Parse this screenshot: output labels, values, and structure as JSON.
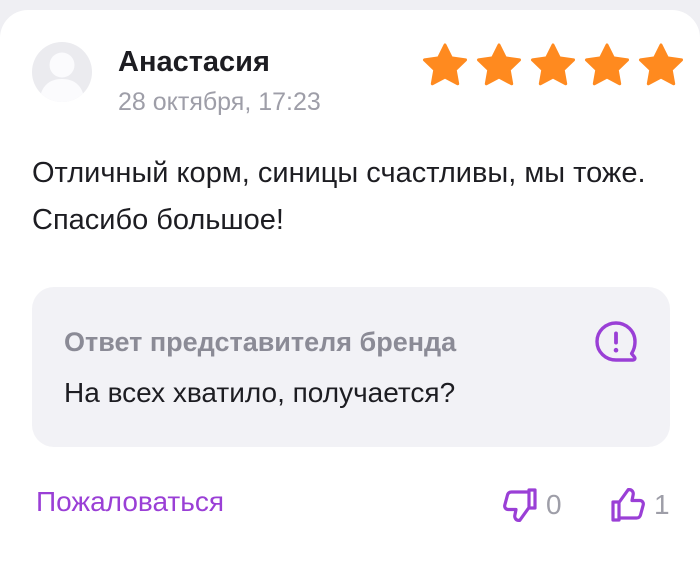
{
  "review": {
    "author_name": "Анастасия",
    "date": "28 октября, 17:23",
    "rating": 5,
    "rating_max": 5,
    "text": "Отличный корм, синицы счастливы, мы тоже. Спасибо большое!"
  },
  "brand_reply": {
    "title": "Ответ представителя бренда",
    "text": "На всех хватило, получается?"
  },
  "actions": {
    "report_label": "Пожаловаться",
    "dislikes": "0",
    "likes": "1"
  },
  "colors": {
    "star": "#ff8a1f",
    "accent": "#9a3fd6",
    "muted": "#9e9ea8"
  },
  "icons": {
    "avatar": "user-silhouette-icon",
    "alert": "exclamation-bubble-icon",
    "dislike": "thumbs-down-icon",
    "like": "thumbs-up-icon",
    "star": "star-icon"
  }
}
